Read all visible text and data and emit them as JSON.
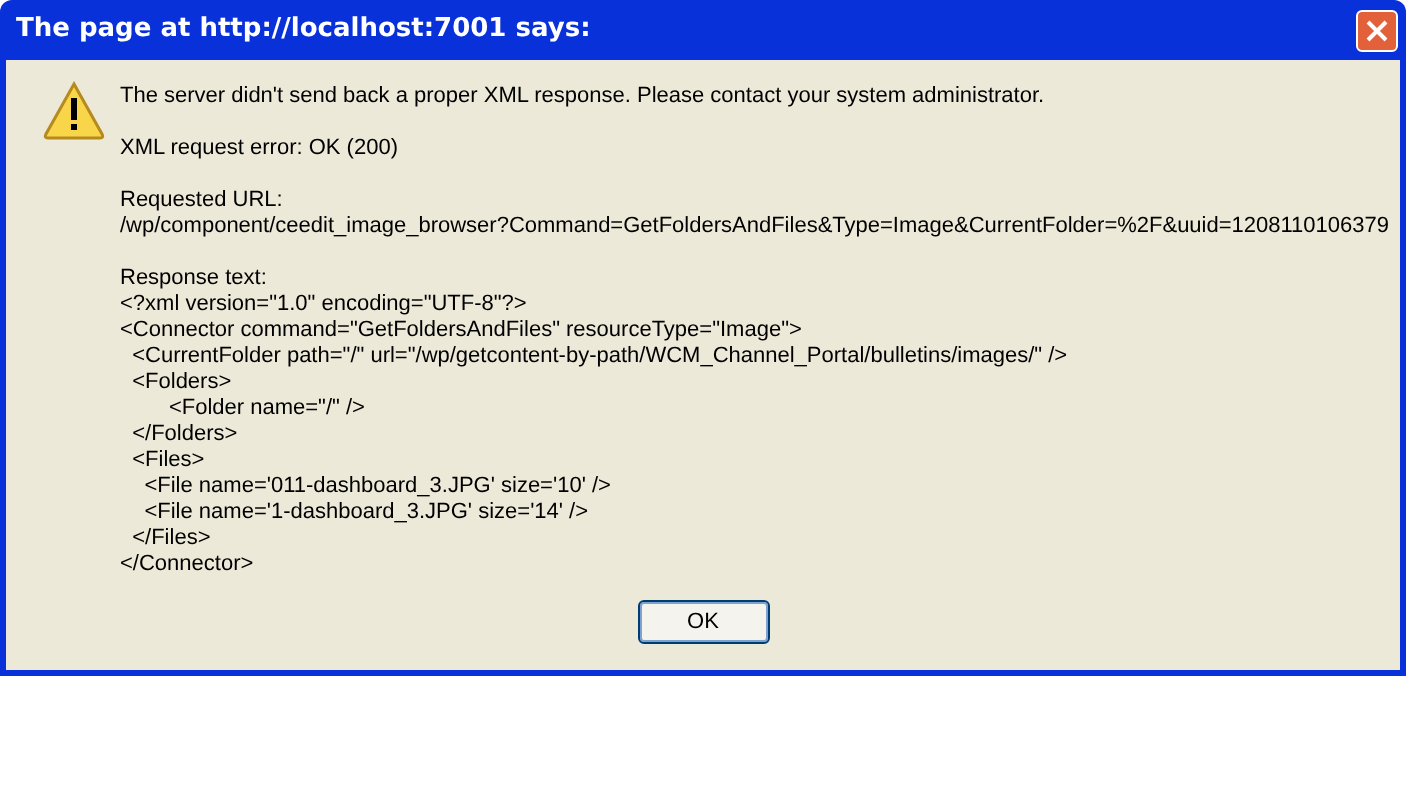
{
  "window": {
    "title": "The page at http://localhost:7001 says:"
  },
  "message": "The server didn't send back a proper XML response. Please contact your system administrator.",
  "error_line": "XML request error: OK (200)",
  "url_label": "Requested URL:",
  "url": "/wp/component/ceedit_image_browser?Command=GetFoldersAndFiles&Type=Image&CurrentFolder=%2F&uuid=1208110106379",
  "response_label": "Response text:",
  "response_lines": [
    "<?xml version=\"1.0\" encoding=\"UTF-8\"?>",
    "<Connector command=\"GetFoldersAndFiles\" resourceType=\"Image\">",
    "  <CurrentFolder path=\"/\" url=\"/wp/getcontent-by-path/WCM_Channel_Portal/bulletins/images/\" />",
    "  <Folders>",
    "        <Folder name=\"/\" />",
    "  </Folders>",
    "  <Files>",
    "    <File name='011-dashboard_3.JPG' size='10' />",
    "    <File name='1-dashboard_3.JPG' size='14' />",
    "  </Files>",
    "</Connector>"
  ],
  "buttons": [
    "OK"
  ]
}
